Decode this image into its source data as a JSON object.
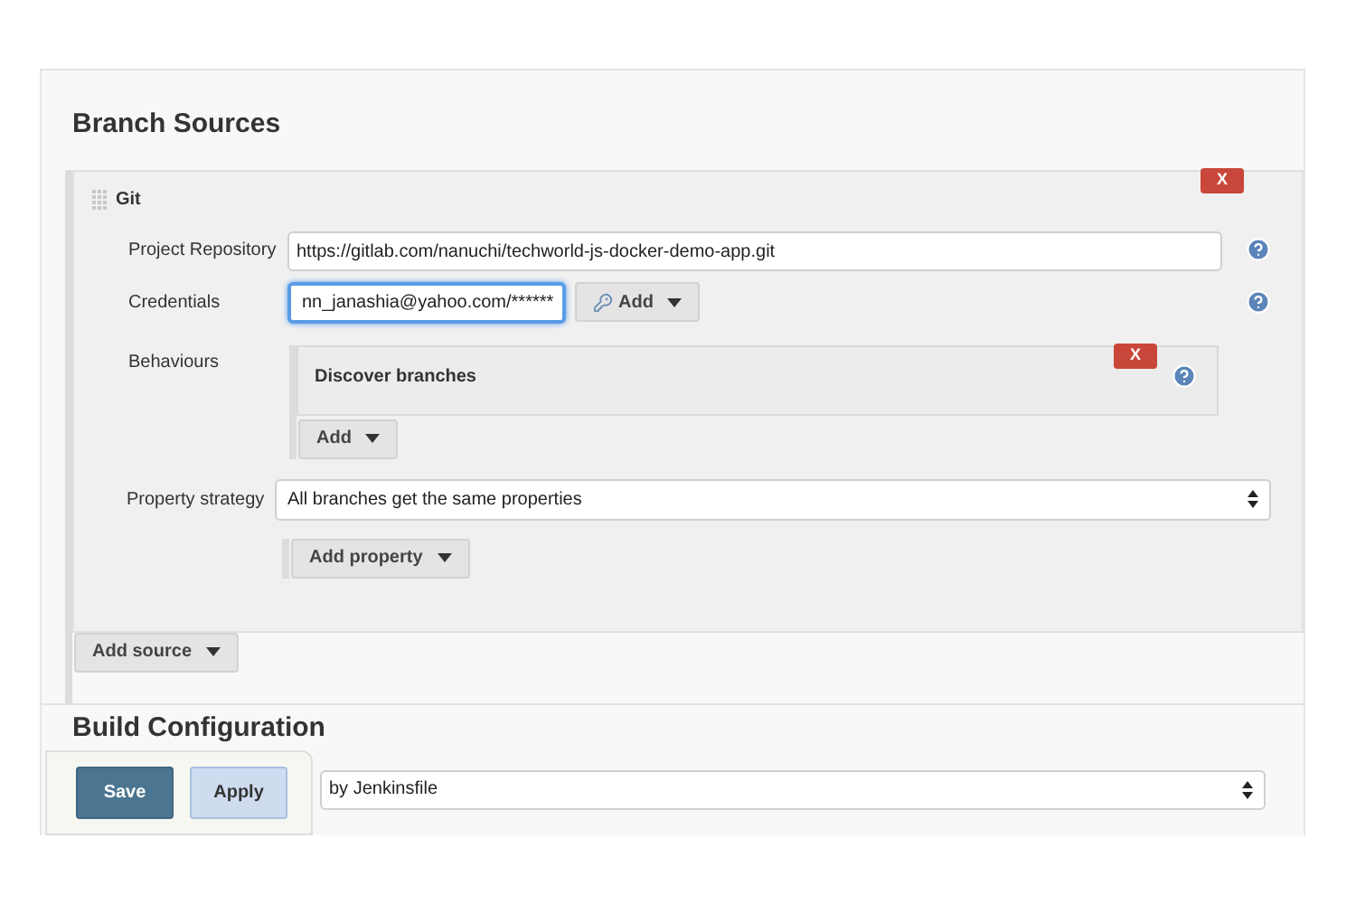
{
  "branch_sources": {
    "title": "Branch Sources",
    "source": {
      "title": "Git",
      "delete_button": "X",
      "fields": [
        {
          "label": "Project Repository",
          "kind": "text",
          "value": "https://gitlab.com/nanuchi/techworld-js-docker-demo-app.git",
          "focused": false
        },
        {
          "label": "Credentials",
          "kind": "select",
          "value": "nn_janashia@yahoo.com/******",
          "focused": true,
          "add_button": "Add"
        }
      ],
      "behaviours": {
        "label": "Behaviours",
        "items": [
          {
            "title": "Discover branches",
            "delete_button": "X"
          }
        ],
        "add_button": "Add"
      },
      "property_strategy": {
        "label": "Property strategy",
        "value": "All branches get the same properties",
        "add_button": "Add property"
      }
    },
    "add_source_button": "Add source"
  },
  "build_configuration": {
    "title": "Build Configuration",
    "mode": "by Jenkinsfile"
  },
  "actions": [
    {
      "label": "Save",
      "kind": "primary"
    },
    {
      "label": "Apply",
      "kind": "secondary"
    }
  ]
}
